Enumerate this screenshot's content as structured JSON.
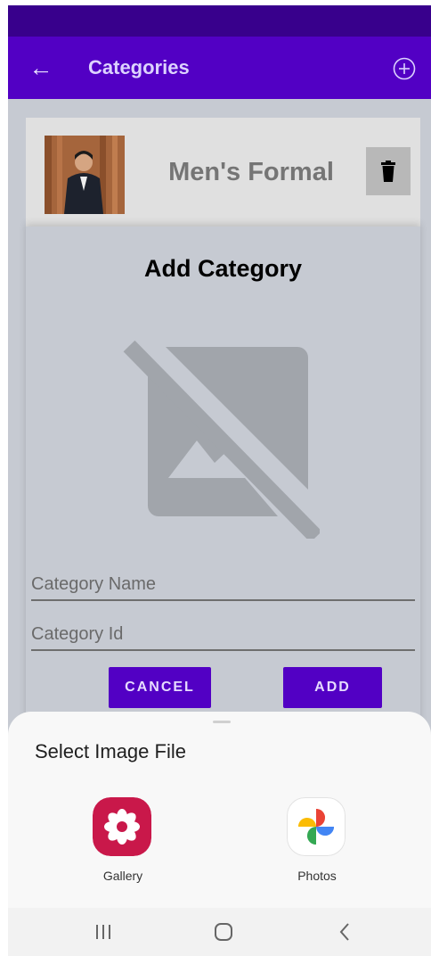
{
  "app_bar": {
    "title": "Categories",
    "back_icon": "back-arrow-icon",
    "add_icon": "add-circle-icon"
  },
  "category_list": [
    {
      "name": "Men's Formal",
      "thumbnail": "man-in-suit-photo",
      "delete_icon": "trash-icon"
    }
  ],
  "dialog": {
    "title": "Add Category",
    "image_placeholder_icon": "no-image-icon",
    "category_name": {
      "value": "",
      "placeholder": "Category Name"
    },
    "category_id": {
      "value": "",
      "placeholder": "Category Id"
    },
    "cancel_label": "CANCEL",
    "add_label": "ADD"
  },
  "bottom_sheet": {
    "title": "Select Image File",
    "targets": [
      {
        "label": "Gallery",
        "icon": "gallery-flower-icon",
        "color": "#c9184a"
      },
      {
        "label": "Photos",
        "icon": "google-photos-pinwheel-icon",
        "color": "#ffffff"
      }
    ]
  },
  "system_nav": {
    "recents_icon": "recents-icon",
    "home_icon": "home-icon",
    "back_icon": "nav-back-icon"
  },
  "colors": {
    "primary": "#5200c4",
    "status_bar": "#38008c",
    "scrim_background": "#c6cad2",
    "card": "#e0e0e0"
  }
}
